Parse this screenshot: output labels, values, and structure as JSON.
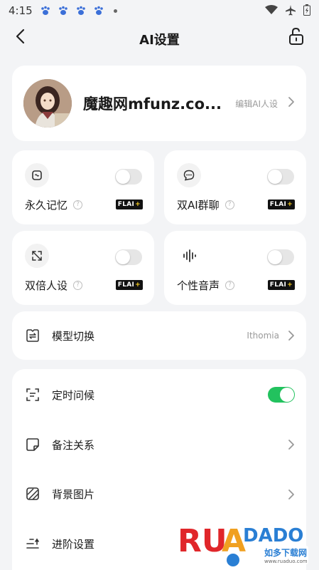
{
  "status_bar": {
    "time": "4:15"
  },
  "header": {
    "title": "AI设置"
  },
  "profile": {
    "name": "魔趣网mfunz.co...",
    "edit_label": "编辑AI人设"
  },
  "features": [
    {
      "label": "永久记忆",
      "badge": "FLAI",
      "enabled": false,
      "icon": "memory-icon"
    },
    {
      "label": "双AI群聊",
      "badge": "FLAI",
      "enabled": false,
      "icon": "chat-bubble-icon"
    },
    {
      "label": "双倍人设",
      "badge": "FLAI",
      "enabled": false,
      "icon": "expand-icon"
    },
    {
      "label": "个性音声",
      "badge": "FLAI",
      "enabled": false,
      "icon": "voice-wave-icon"
    }
  ],
  "model": {
    "label": "模型切换",
    "value": "Ithomia"
  },
  "settings": [
    {
      "label": "定时问候",
      "toggle": true,
      "icon": "scan-text-icon"
    },
    {
      "label": "备注关系",
      "icon": "note-icon"
    },
    {
      "label": "背景图片",
      "icon": "striped-square-icon"
    },
    {
      "label": "进阶设置",
      "icon": "advanced-settings-icon"
    }
  ],
  "watermark": {
    "brand": "RUADADO",
    "cn": "如多下载网",
    "url": "www.ruaduo.com"
  },
  "colors": {
    "accent_green": "#22c25e",
    "background": "#f3f4f6",
    "card": "#ffffff"
  }
}
